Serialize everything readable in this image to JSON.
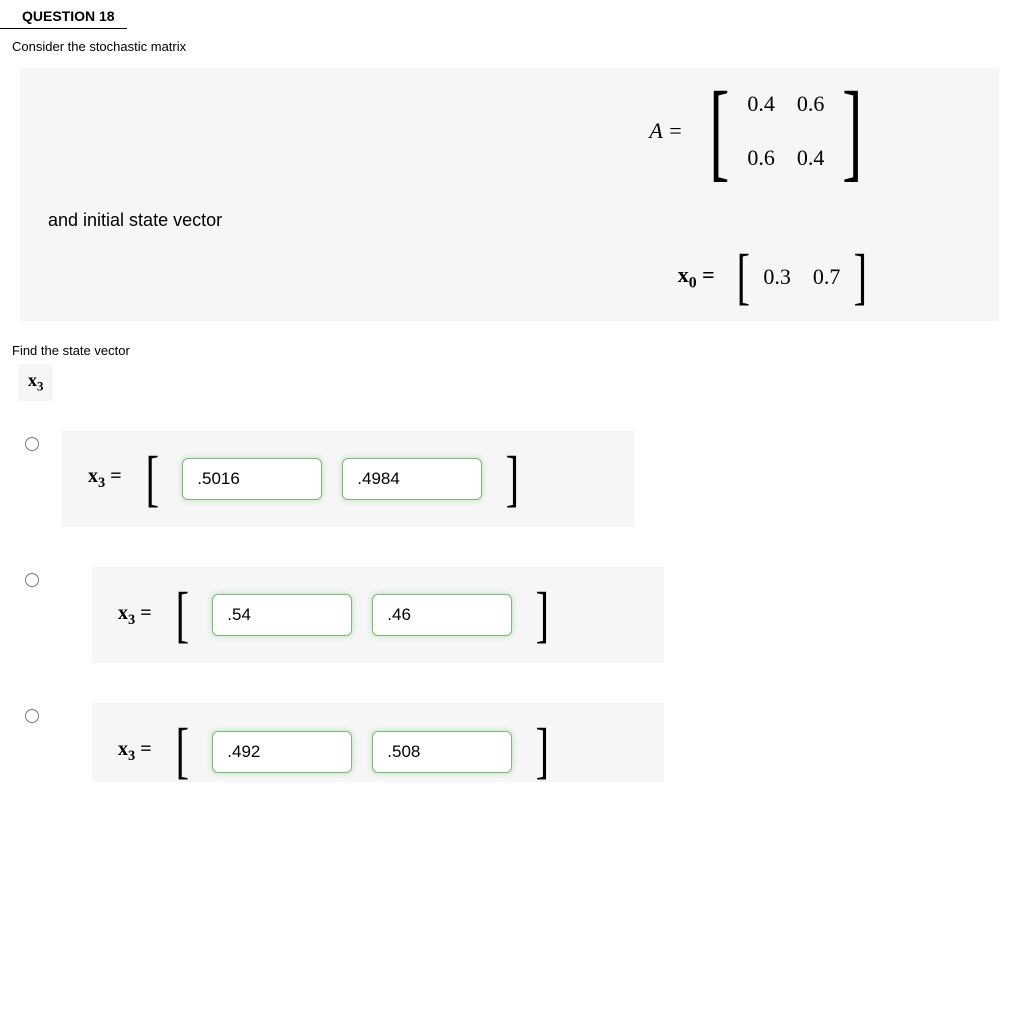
{
  "question_header": "QUESTION 18",
  "prompt": "Consider the stochastic matrix",
  "matrix_label": "A =",
  "matrix_A": {
    "r1c1": "0.4",
    "r1c2": "0.6",
    "r2c1": "0.6",
    "r2c2": "0.4"
  },
  "initial_text": "and initial state vector",
  "x0_label_var": "x",
  "x0_label_sub": "0",
  "x0_values": {
    "v1": "0.3",
    "v2": "0.7"
  },
  "find_text": "Find the state vector",
  "x3_tag_var": "x",
  "x3_tag_sub": "3",
  "answer_label_var": "x",
  "answer_label_sub": "3",
  "eq": " =",
  "options": {
    "a": {
      "v1": ".5016",
      "v2": ".4984"
    },
    "b": {
      "v1": ".54",
      "v2": ".46"
    },
    "c": {
      "v1": ".492",
      "v2": ".508"
    }
  }
}
